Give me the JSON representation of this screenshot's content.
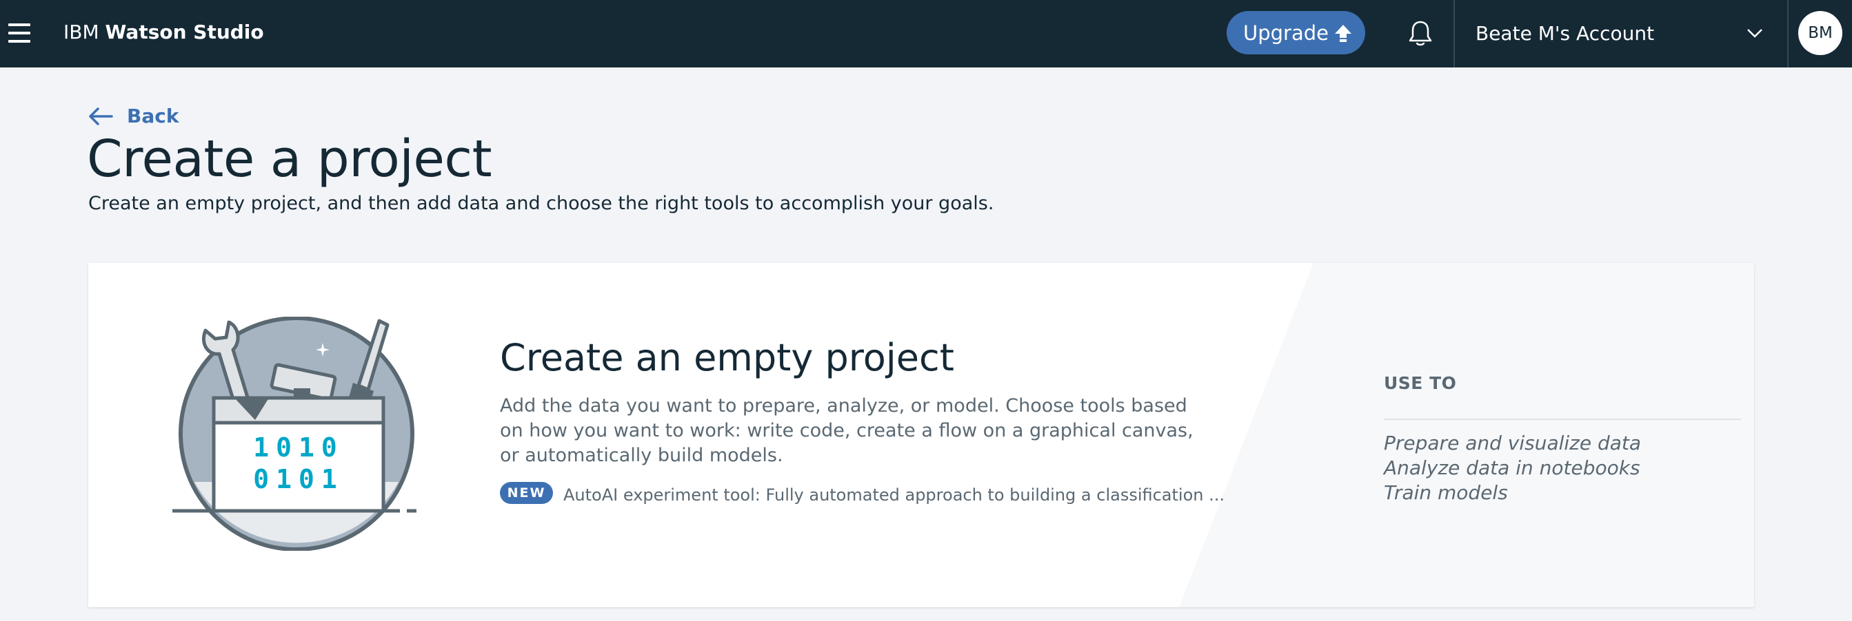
{
  "header": {
    "brand_prefix": "IBM",
    "brand_name": "Watson Studio",
    "upgrade_label": "Upgrade",
    "account_label": "Beate M's Account",
    "avatar_initials": "BM"
  },
  "page": {
    "back_label": "Back",
    "title": "Create a project",
    "subtitle": "Create an empty project, and then add data and choose the right tools to accomplish your goals."
  },
  "card": {
    "title": "Create an empty project",
    "description": "Add the data you want to prepare, analyze, or model. Choose tools based on how you want to work: write code, create a flow on a graphical canvas, or automatically build models.",
    "badge": "NEW",
    "badge_text": "AutoAI experiment tool: Fully automated approach to building a classification ...",
    "illustration_binary_1": "1010",
    "illustration_binary_2": "0101",
    "use_to_heading": "USE TO",
    "use_to_items": [
      "Prepare and visualize data",
      "Analyze data in notebooks",
      "Train models"
    ]
  },
  "icons": [
    "menu-icon",
    "upload-arrow-icon",
    "notification-bell-icon",
    "chevron-down-icon",
    "back-arrow-icon",
    "toolbox-illustration"
  ],
  "colors": {
    "topbar": "#152935",
    "accent": "#3d70b2",
    "page_background": "#f2f4f8",
    "binary_digits": "#00a6c8"
  }
}
